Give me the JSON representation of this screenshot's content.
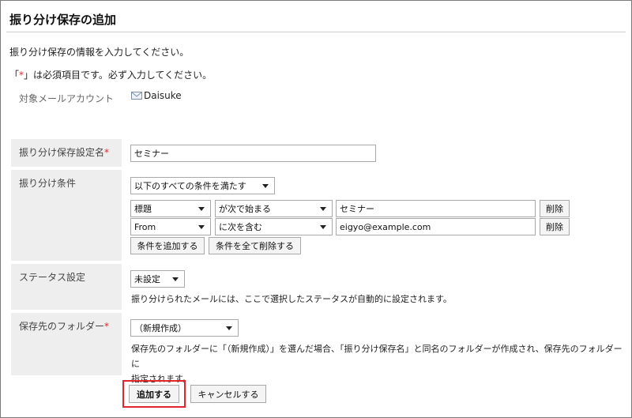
{
  "page": {
    "title": "振り分け保存の追加",
    "instruction": "振り分け保存の情報を入力してください。",
    "required_note_prefix": "「",
    "required_star": "*",
    "required_note_suffix": "」は必須項目です。必ず入力してください。"
  },
  "account": {
    "label": "対象メールアカウント",
    "value": "Daisuke",
    "icon": "mail-icon"
  },
  "setting_name": {
    "label": "振り分け保存設定名",
    "required_star": "*",
    "value": "セミナー"
  },
  "conditions": {
    "label": "振り分け条件",
    "match_mode": "以下のすべての条件を満たす",
    "rows": [
      {
        "field": "標題",
        "operator": "が次で始まる",
        "value": "セミナー",
        "delete_label": "削除"
      },
      {
        "field": "From",
        "operator": "に次を含む",
        "value": "eigyo@example.com",
        "delete_label": "削除"
      }
    ],
    "add_label": "条件を追加する",
    "delete_all_label": "条件を全て削除する"
  },
  "status": {
    "label": "ステータス設定",
    "value": "未設定",
    "hint": "振り分けられたメールには、ここで選択したステータスが自動的に設定されます。"
  },
  "folder": {
    "label": "保存先のフォルダー",
    "required_star": "*",
    "value": "（新規作成）",
    "hint_line1": "保存先のフォルダーに「（新規作成）」を選んだ場合、「振り分け保存名」と同名のフォルダーが作成され、保存先のフォルダーに",
    "hint_line2": "指定されます。"
  },
  "actions": {
    "submit_label": "追加する",
    "cancel_label": "キャンセルする"
  },
  "colors": {
    "required": "#e0262e",
    "label_bg": "#eeeeee",
    "highlight": "#e0262e"
  }
}
